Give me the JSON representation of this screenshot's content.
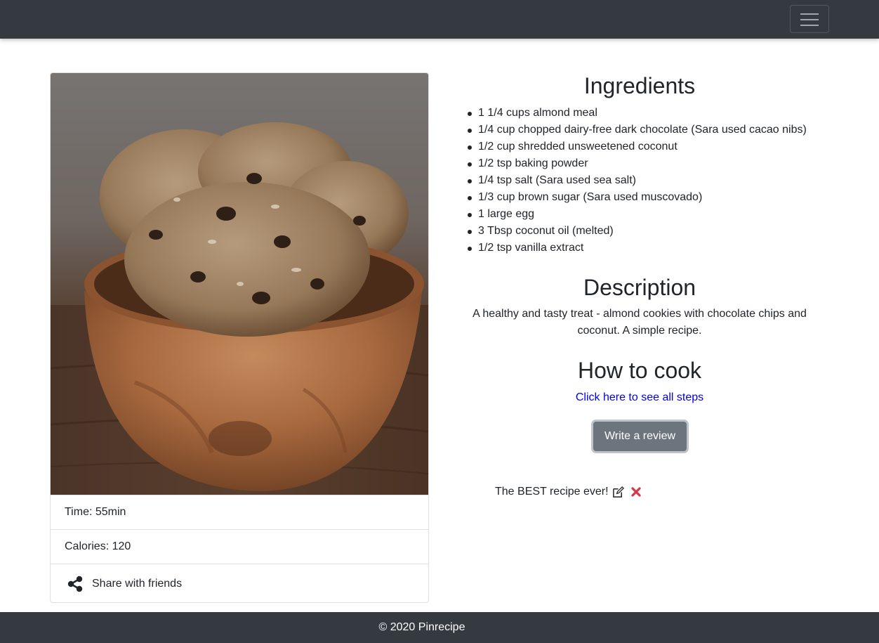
{
  "navbar": {
    "toggler_icon": "hamburger-menu-icon"
  },
  "recipe_card": {
    "image_alt": "almond cookies in a wooden bowl",
    "time": "Time: 55min",
    "calories": "Calories: 120",
    "share_label": "Share with friends",
    "share_icon": "share-icon"
  },
  "ingredients": {
    "heading": "Ingredients",
    "items": [
      "1 1/4 cups almond meal",
      "1/4 cup chopped dairy-free dark chocolate (Sara used cacao nibs)",
      "1/2 cup shredded unsweetened coconut",
      "1/2 tsp baking powder",
      "1/4 tsp salt (Sara used sea salt)",
      "1/3 cup brown sugar (Sara used muscovado)",
      "1 large egg",
      "3 Tbsp coconut oil (melted)",
      "1/2 tsp vanilla extract"
    ]
  },
  "description": {
    "heading": "Description",
    "text": "A healthy and tasty treat - almond cookies with chocolate chips and coconut. A simple recipe."
  },
  "how_to_cook": {
    "heading": "How to cook",
    "link_text": "Click here to see all steps",
    "review_button": "Write a review"
  },
  "reviews": [
    {
      "text": "The BEST recipe ever!",
      "edit_icon": "edit-icon",
      "delete_icon": "delete-icon"
    }
  ],
  "footer": {
    "text": "© 2020 Pinrecipe"
  },
  "colors": {
    "navbar_bg": "#343a40",
    "link": "#0000ee",
    "button_secondary": "#6c757d",
    "delete": "#dc3545"
  }
}
